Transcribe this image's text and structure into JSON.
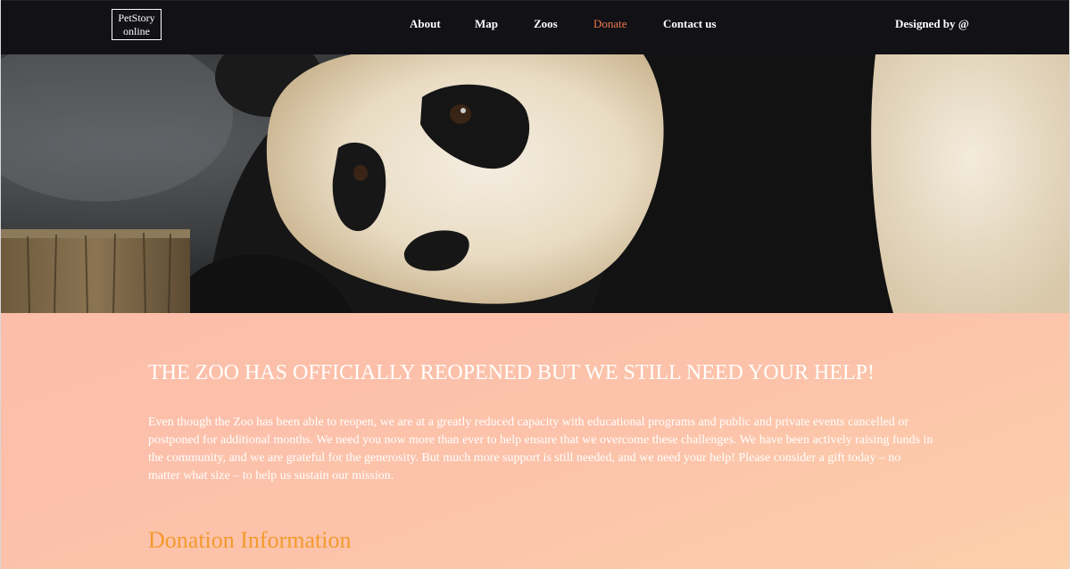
{
  "header": {
    "logo_line1": "PetStory",
    "logo_line2": "online",
    "nav": {
      "about": "About",
      "map": "Map",
      "zoos": "Zoos",
      "donate": "Donate",
      "contact": "Contact us"
    },
    "credit": "Designed by @",
    "active_color": "#f07a4d"
  },
  "hero": {
    "image": "giant-panda-photo"
  },
  "main": {
    "headline": "THE ZOO HAS OFFICIALLY REOPENED BUT WE STILL NEED YOUR HELP!",
    "intro": "Even though the Zoo has been able to reopen, we are at a greatly reduced capacity with educational programs and public and private events cancelled or postponed for additional months. We need you now more than ever to help ensure that we overcome these challenges. We have been actively raising funds in the community, and we are grateful for the generosity. But much more support is still needed, and we need your help! Please consider a gift today – no matter what size – to help us sustain our mission.",
    "section_title": "Donation Information",
    "section_title_color": "#f39a2d",
    "background_color": "#fcc3aa"
  }
}
